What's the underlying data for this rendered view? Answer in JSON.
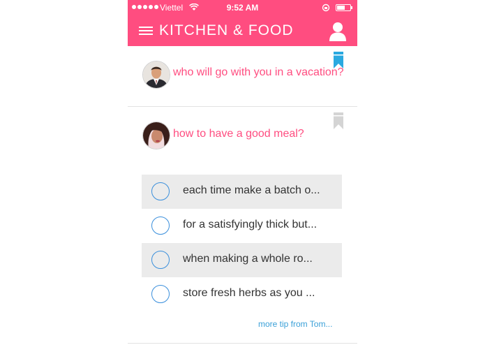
{
  "status_bar": {
    "carrier": "Viettel",
    "time": "9:52 AM",
    "battery_level": 0.6
  },
  "nav": {
    "title": "KITCHEN & FOOD"
  },
  "colors": {
    "accent": "#ff4d80",
    "link": "#3aa0d8",
    "radio": "#3a8fdc",
    "bookmark_active": "#2aa9e0",
    "bookmark_inactive": "#d4d4d4"
  },
  "questions": [
    {
      "text": "who will go with you in a vacation?",
      "bookmarked": true,
      "avatar": "man-avatar"
    },
    {
      "text": "how to have a good meal?",
      "bookmarked": false,
      "avatar": "woman-avatar",
      "tips": [
        {
          "text": "each time make a batch o...",
          "shaded": true
        },
        {
          "text": "for a satisfyingly thick but...",
          "shaded": false
        },
        {
          "text": "when making a whole ro...",
          "shaded": true
        },
        {
          "text": "store fresh herbs as you ...",
          "shaded": false
        }
      ],
      "more_link": "more tip from Tom..."
    }
  ]
}
